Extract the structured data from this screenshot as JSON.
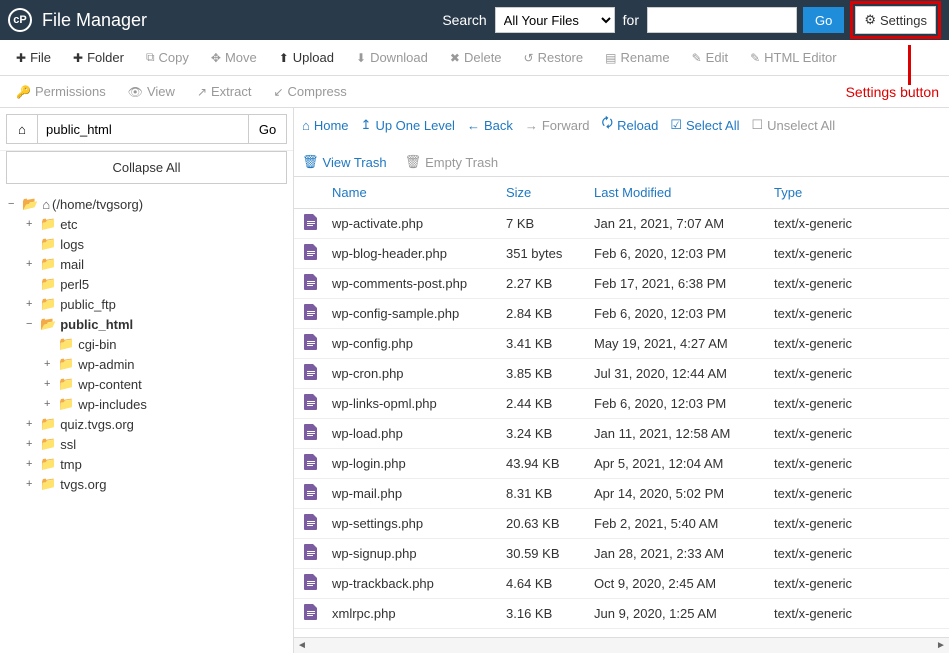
{
  "header": {
    "app_title": "File Manager",
    "search_label": "Search",
    "for_label": "for",
    "select_value": "All Your Files",
    "search_value": "",
    "go_label": "Go",
    "settings_label": "Settings"
  },
  "toolbar": {
    "file": "File",
    "folder": "Folder",
    "copy": "Copy",
    "move": "Move",
    "upload": "Upload",
    "download": "Download",
    "delete": "Delete",
    "restore": "Restore",
    "rename": "Rename",
    "edit": "Edit",
    "html_editor": "HTML Editor",
    "permissions": "Permissions",
    "view": "View",
    "extract": "Extract",
    "compress": "Compress"
  },
  "callout": "Settings button",
  "left": {
    "path_value": "public_html",
    "go_label": "Go",
    "collapse_label": "Collapse All"
  },
  "tree": {
    "root": "(/home/tvgsorg)",
    "items": [
      {
        "label": "etc",
        "depth": 1,
        "toggle": "+"
      },
      {
        "label": "logs",
        "depth": 1,
        "toggle": ""
      },
      {
        "label": "mail",
        "depth": 1,
        "toggle": "+"
      },
      {
        "label": "perl5",
        "depth": 1,
        "toggle": ""
      },
      {
        "label": "public_ftp",
        "depth": 1,
        "toggle": "+"
      },
      {
        "label": "public_html",
        "depth": 1,
        "toggle": "−",
        "bold": true,
        "open": true
      },
      {
        "label": "cgi-bin",
        "depth": 2,
        "toggle": ""
      },
      {
        "label": "wp-admin",
        "depth": 2,
        "toggle": "+"
      },
      {
        "label": "wp-content",
        "depth": 2,
        "toggle": "+"
      },
      {
        "label": "wp-includes",
        "depth": 2,
        "toggle": "+"
      },
      {
        "label": "quiz.tvgs.org",
        "depth": 1,
        "toggle": "+"
      },
      {
        "label": "ssl",
        "depth": 1,
        "toggle": "+"
      },
      {
        "label": "tmp",
        "depth": 1,
        "toggle": "+"
      },
      {
        "label": "tvgs.org",
        "depth": 1,
        "toggle": "+"
      }
    ]
  },
  "actions": {
    "home": "Home",
    "up": "Up One Level",
    "back": "Back",
    "forward": "Forward",
    "reload": "Reload",
    "select_all": "Select All",
    "unselect_all": "Unselect All",
    "view_trash": "View Trash",
    "empty_trash": "Empty Trash"
  },
  "columns": {
    "name": "Name",
    "size": "Size",
    "modified": "Last Modified",
    "type": "Type"
  },
  "files": [
    {
      "name": "wp-activate.php",
      "size": "7 KB",
      "modified": "Jan 21, 2021, 7:07 AM",
      "type": "text/x-generic"
    },
    {
      "name": "wp-blog-header.php",
      "size": "351 bytes",
      "modified": "Feb 6, 2020, 12:03 PM",
      "type": "text/x-generic"
    },
    {
      "name": "wp-comments-post.php",
      "size": "2.27 KB",
      "modified": "Feb 17, 2021, 6:38 PM",
      "type": "text/x-generic"
    },
    {
      "name": "wp-config-sample.php",
      "size": "2.84 KB",
      "modified": "Feb 6, 2020, 12:03 PM",
      "type": "text/x-generic"
    },
    {
      "name": "wp-config.php",
      "size": "3.41 KB",
      "modified": "May 19, 2021, 4:27 AM",
      "type": "text/x-generic"
    },
    {
      "name": "wp-cron.php",
      "size": "3.85 KB",
      "modified": "Jul 31, 2020, 12:44 AM",
      "type": "text/x-generic"
    },
    {
      "name": "wp-links-opml.php",
      "size": "2.44 KB",
      "modified": "Feb 6, 2020, 12:03 PM",
      "type": "text/x-generic"
    },
    {
      "name": "wp-load.php",
      "size": "3.24 KB",
      "modified": "Jan 11, 2021, 12:58 AM",
      "type": "text/x-generic"
    },
    {
      "name": "wp-login.php",
      "size": "43.94 KB",
      "modified": "Apr 5, 2021, 12:04 AM",
      "type": "text/x-generic"
    },
    {
      "name": "wp-mail.php",
      "size": "8.31 KB",
      "modified": "Apr 14, 2020, 5:02 PM",
      "type": "text/x-generic"
    },
    {
      "name": "wp-settings.php",
      "size": "20.63 KB",
      "modified": "Feb 2, 2021, 5:40 AM",
      "type": "text/x-generic"
    },
    {
      "name": "wp-signup.php",
      "size": "30.59 KB",
      "modified": "Jan 28, 2021, 2:33 AM",
      "type": "text/x-generic"
    },
    {
      "name": "wp-trackback.php",
      "size": "4.64 KB",
      "modified": "Oct 9, 2020, 2:45 AM",
      "type": "text/x-generic"
    },
    {
      "name": "xmlrpc.php",
      "size": "3.16 KB",
      "modified": "Jun 9, 2020, 1:25 AM",
      "type": "text/x-generic"
    }
  ]
}
